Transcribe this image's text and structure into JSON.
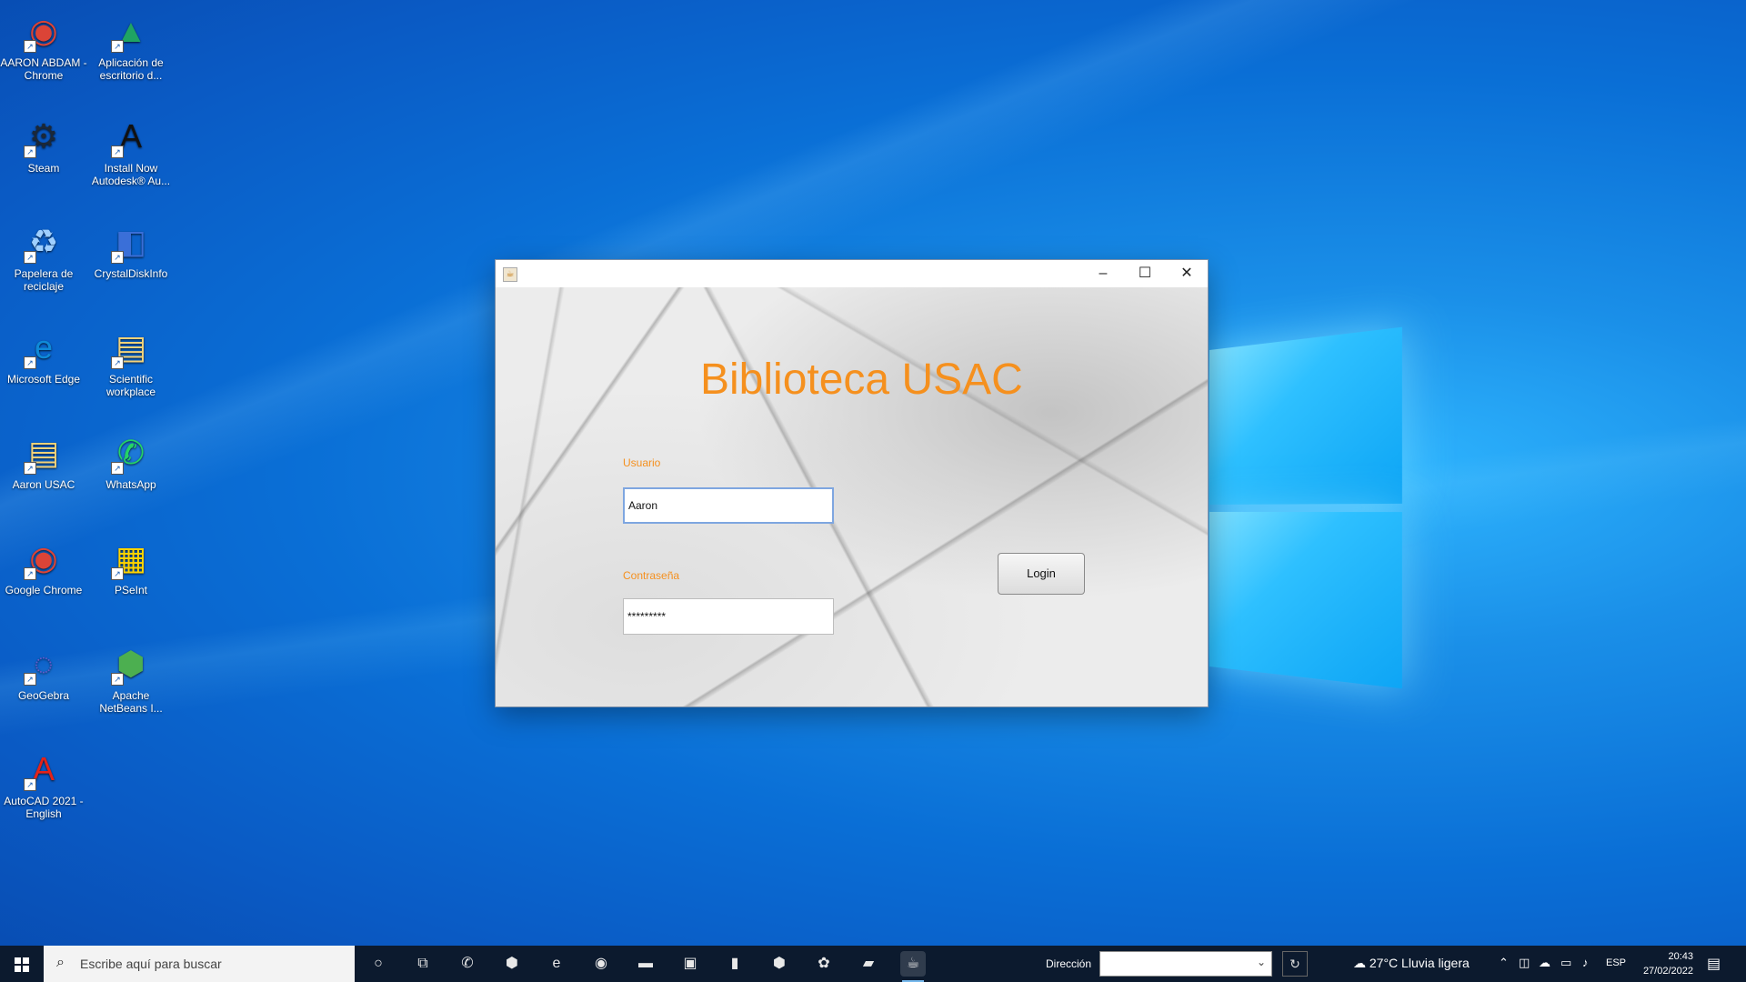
{
  "desktop": {
    "icons": [
      {
        "label": "AARON ABDAM - Chrome",
        "glyph": "◉",
        "color": "#db4437"
      },
      {
        "label": "Aplicación de escritorio d...",
        "glyph": "▲",
        "color": "#1fa463"
      },
      {
        "label": "Steam",
        "glyph": "⚙",
        "color": "#1b2838"
      },
      {
        "label": "Install Now Autodesk® Au...",
        "glyph": "A",
        "color": "#111111"
      },
      {
        "label": "Papelera de reciclaje",
        "glyph": "♻",
        "color": "#9ecfff"
      },
      {
        "label": "CrystalDiskInfo",
        "glyph": "◧",
        "color": "#3a6fd8"
      },
      {
        "label": "Microsoft Edge",
        "glyph": "e",
        "color": "#0f8ad8"
      },
      {
        "label": "Scientific workplace",
        "glyph": "▤",
        "color": "#f2d27a"
      },
      {
        "label": "Aaron USAC",
        "glyph": "▤",
        "color": "#f2d27a"
      },
      {
        "label": "WhatsApp",
        "glyph": "✆",
        "color": "#25d366"
      },
      {
        "label": "Google Chrome",
        "glyph": "◉",
        "color": "#db4437"
      },
      {
        "label": "PSeInt",
        "glyph": "▦",
        "color": "#ffd400"
      },
      {
        "label": "GeoGebra",
        "glyph": "◌",
        "color": "#6a5acd"
      },
      {
        "label": "Apache NetBeans I...",
        "glyph": "⬢",
        "color": "#4caf50"
      },
      {
        "label": "AutoCAD 2021 - English",
        "glyph": "A",
        "color": "#e2231a"
      }
    ]
  },
  "window": {
    "app_icon": "java-icon",
    "controls": {
      "minimize": "–",
      "maximize": "☐",
      "close": "✕"
    },
    "title": "Biblioteca USAC",
    "user_label": "Usuario",
    "user_value": "Aaron",
    "pass_label": "Contraseña",
    "pass_value": "*********",
    "login_label": "Login",
    "accent_color": "#f5901e"
  },
  "taskbar": {
    "search_placeholder": "Escribe aquí para buscar",
    "apps": [
      {
        "name": "cortana-icon",
        "glyph": "○"
      },
      {
        "name": "task-view-icon",
        "glyph": "⧉"
      },
      {
        "name": "whatsapp-icon",
        "glyph": "✆"
      },
      {
        "name": "app-hex-icon",
        "glyph": "⬢"
      },
      {
        "name": "edge-icon",
        "glyph": "e"
      },
      {
        "name": "chrome-icon",
        "glyph": "◉"
      },
      {
        "name": "file-explorer-icon",
        "glyph": "▬"
      },
      {
        "name": "store-icon",
        "glyph": "▣"
      },
      {
        "name": "office-icon",
        "glyph": "▮"
      },
      {
        "name": "netbeans-icon",
        "glyph": "⬢"
      },
      {
        "name": "paint-icon",
        "glyph": "✿"
      },
      {
        "name": "notes-icon",
        "glyph": "▰"
      },
      {
        "name": "java-icon",
        "glyph": "☕"
      }
    ],
    "direccion_label": "Dirección",
    "weather": "27°C  Lluvia ligera",
    "language": "ESP",
    "time": "20:43",
    "date": "27/02/2022"
  }
}
